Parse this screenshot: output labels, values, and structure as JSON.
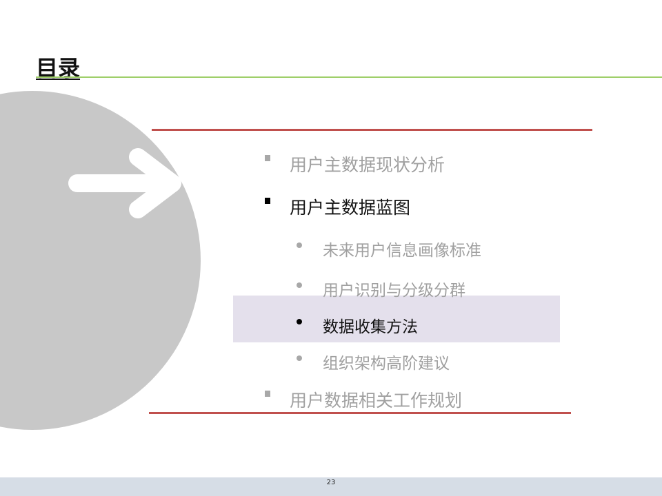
{
  "slide": {
    "title": "目录",
    "page_number": "23"
  },
  "agenda": [
    {
      "label": "用户主数据现状分析",
      "level": 1,
      "state": "inactive"
    },
    {
      "label": "用户主数据蓝图",
      "level": 1,
      "state": "active"
    },
    {
      "label": "未来用户信息画像标准",
      "level": 2,
      "state": "inactive"
    },
    {
      "label": "用户识别与分级分群",
      "level": 2,
      "state": "inactive"
    },
    {
      "label": "数据收集方法",
      "level": 2,
      "state": "current"
    },
    {
      "label": "组织架构高阶建议",
      "level": 2,
      "state": "inactive"
    },
    {
      "label": "用户数据相关工作规划",
      "level": 1,
      "state": "inactive"
    }
  ],
  "colors": {
    "title_rule": "#9fcf6a",
    "frame_rule": "#c0504d",
    "highlight": "#e4e0ec",
    "circle": "#c8c8c8",
    "footer": "#d6dde6"
  },
  "icons": {
    "decoration": "arrow-right-icon"
  }
}
